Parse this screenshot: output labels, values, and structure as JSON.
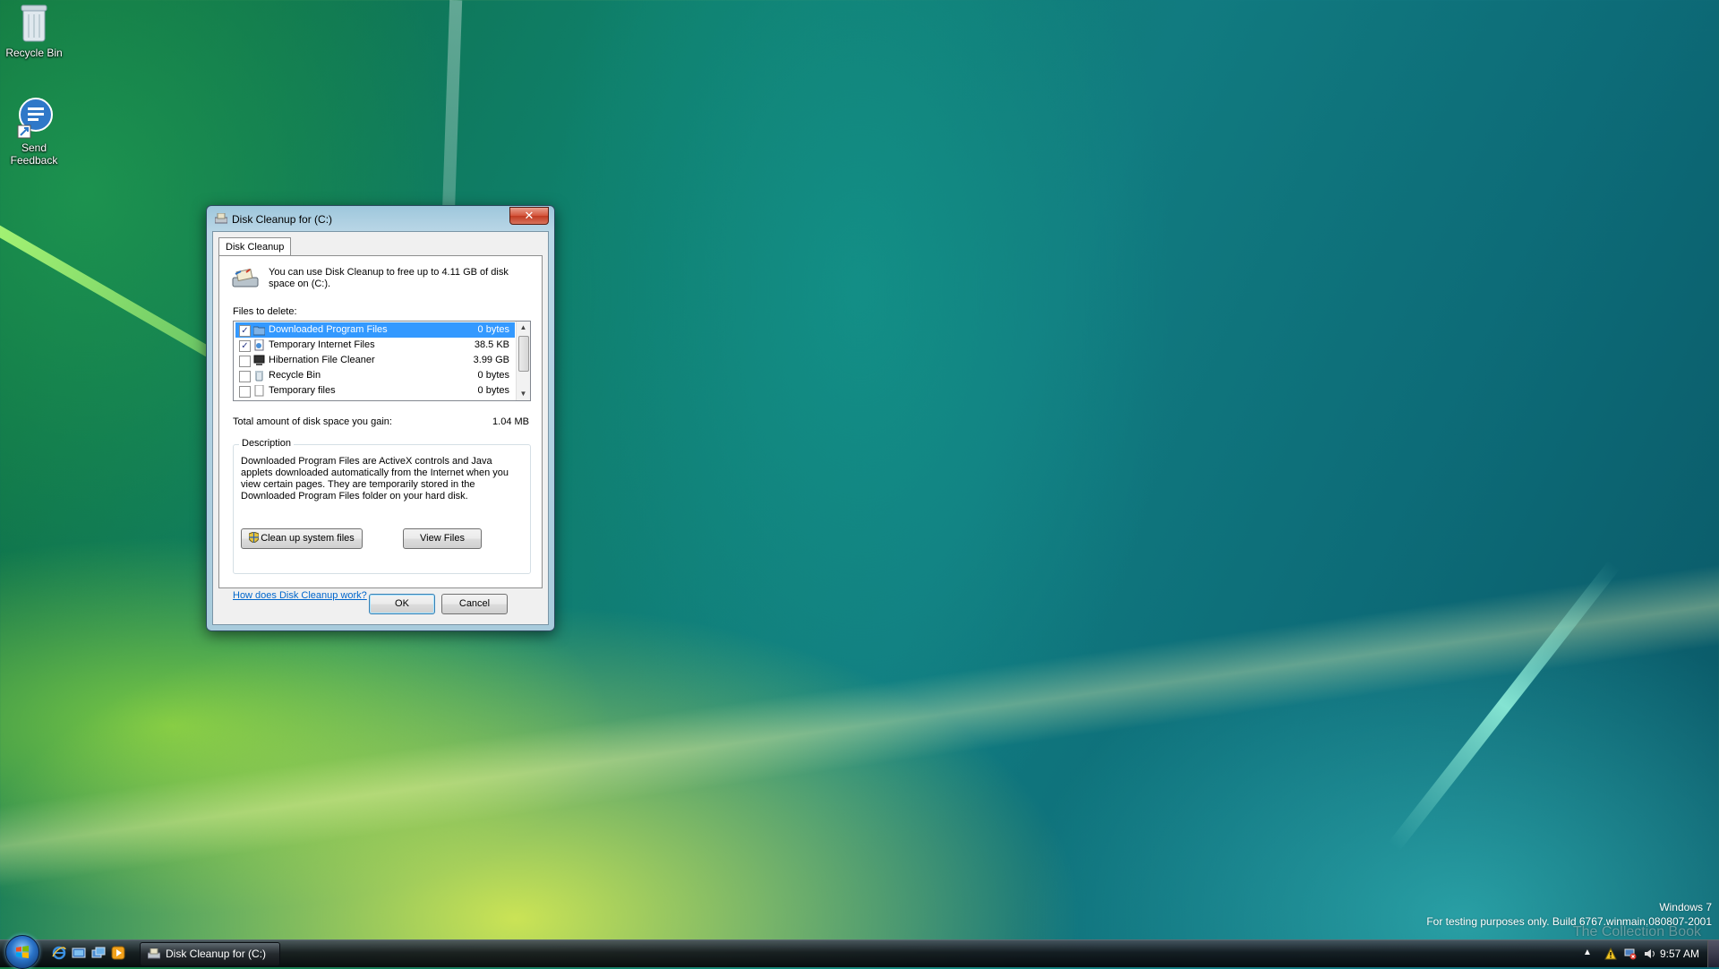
{
  "desktop": {
    "icons": [
      {
        "label": "Recycle Bin"
      },
      {
        "label": "Send\nFeedback",
        "label_line1": "Send",
        "label_line2": "Feedback"
      }
    ],
    "watermark": {
      "line1": "Windows 7",
      "line2": "For testing purposes only. Build 6767.winmain.080807-2001",
      "overlay": "The Collection Book"
    }
  },
  "dialog": {
    "title": "Disk Cleanup for  (C:)",
    "close_label": "✕",
    "tab_label": "Disk Cleanup",
    "intro_text": "You can use Disk Cleanup to free up to 4.11 GB of disk space on  (C:).",
    "files_to_delete_label": "Files to delete:",
    "files": [
      {
        "name": "Downloaded Program Files",
        "size": "0 bytes",
        "checked": true,
        "selected": true,
        "icon": "folder-icon"
      },
      {
        "name": "Temporary Internet Files",
        "size": "38.5 KB",
        "checked": true,
        "selected": false,
        "icon": "document-icon"
      },
      {
        "name": "Hibernation File Cleaner",
        "size": "3.99 GB",
        "checked": false,
        "selected": false,
        "icon": "computer-icon"
      },
      {
        "name": "Recycle Bin",
        "size": "0 bytes",
        "checked": false,
        "selected": false,
        "icon": "recycle-bin-icon"
      },
      {
        "name": "Temporary files",
        "size": "0 bytes",
        "checked": false,
        "selected": false,
        "icon": "file-icon"
      }
    ],
    "total_label": "Total amount of disk space you gain:",
    "total_value": "1.04 MB",
    "description_title": "Description",
    "description_text": "Downloaded Program Files are ActiveX controls and Java applets downloaded automatically from the Internet when you view certain pages. They are temporarily stored in the Downloaded Program Files folder on your hard disk.",
    "cleanup_system_button": "Clean up system files",
    "view_files_button": "View Files",
    "help_link": "How does Disk Cleanup work?",
    "ok_button": "OK",
    "cancel_button": "Cancel"
  },
  "taskbar": {
    "active_task": "Disk Cleanup for  (C:)",
    "clock": "9:57 AM",
    "quick_launch": [
      "internet-explorer-icon",
      "show-desktop-icon",
      "switch-windows-icon",
      "media-player-icon"
    ]
  },
  "colors": {
    "selection": "#3399ff",
    "link": "#0066cc",
    "close_button": "#c13b22"
  }
}
